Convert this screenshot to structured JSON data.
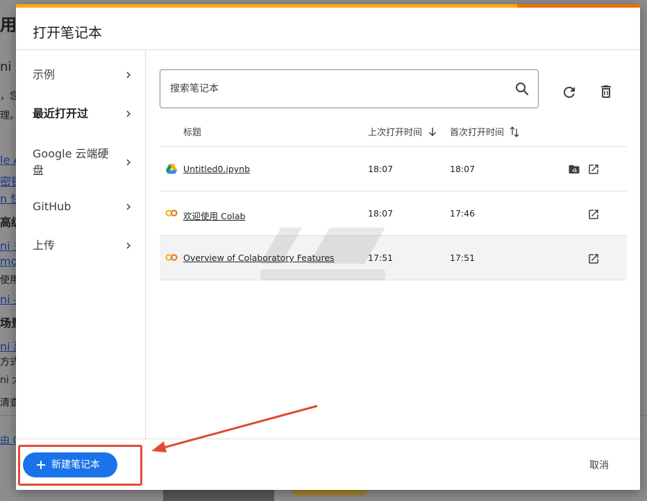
{
  "background": {
    "fragments": [
      "用（",
      "ni A",
      "，您",
      "理。",
      "le A",
      "密钥,",
      "n 快",
      "高级",
      "ni 多",
      "mod",
      "使用",
      "ni 身",
      "场景",
      "ni 建",
      "方式,",
      "ni 大",
      "清查",
      "由 G"
    ]
  },
  "dialog": {
    "title": "打开笔记本",
    "sidebar": [
      {
        "label": "示例"
      },
      {
        "label": "最近打开过"
      },
      {
        "label": "Google 云端硬盘"
      },
      {
        "label": "GitHub"
      },
      {
        "label": "上传"
      }
    ],
    "search": {
      "placeholder": "搜索笔记本",
      "value": ""
    },
    "table": {
      "headers": {
        "title": "标题",
        "last_opened": "上次打开时间",
        "first_opened": "首次打开时间"
      },
      "rows": [
        {
          "icon": "google-drive-icon",
          "title": "Untitled0.ipynb",
          "last_opened": "18:07",
          "first_opened": "18:07"
        },
        {
          "icon": "colab-icon",
          "title": "欢迎使用 Colab",
          "last_opened": "18:07",
          "first_opened": "17:46"
        },
        {
          "icon": "colab-icon",
          "title": "Overview of Colaboratory Features",
          "last_opened": "17:51",
          "first_opened": "17:51"
        }
      ]
    },
    "new_notebook_label": "新建笔记本",
    "cancel_label": "取消"
  },
  "colors": {
    "accent": "#1a73e8",
    "annotation": "#e04a32",
    "strip": "#f9ab00",
    "strip_end": "#e8710a",
    "colab": "#f9ab00"
  }
}
